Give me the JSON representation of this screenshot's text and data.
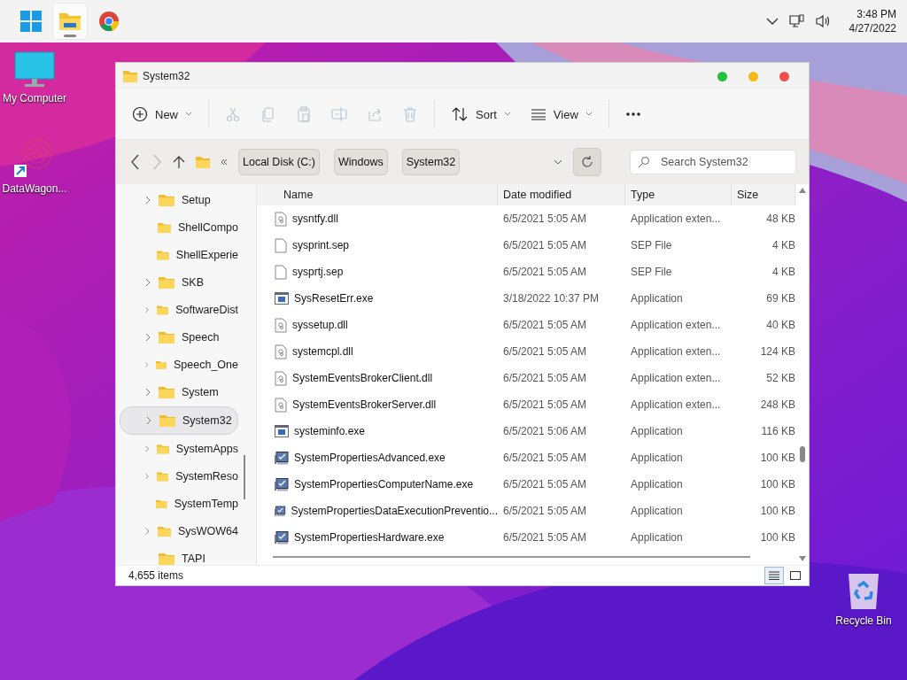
{
  "taskbar": {
    "apps": [
      {
        "kind": "start",
        "selected": false
      },
      {
        "kind": "explorer",
        "selected": true
      },
      {
        "kind": "chrome",
        "selected": false
      }
    ],
    "clock": {
      "time": "3:48 PM",
      "date": "4/27/2022"
    }
  },
  "desktop_icons": [
    {
      "kind": "computer",
      "label": "My Computer"
    },
    {
      "kind": "shortcut",
      "label": "DataWagon..."
    },
    {
      "kind": "recycle",
      "label": "Recycle Bin"
    }
  ],
  "window": {
    "title": "System32",
    "toolbar": [
      {
        "kind": "new",
        "label": "New",
        "disabled": false
      },
      {
        "kind": "cut",
        "disabled": true
      },
      {
        "kind": "copy",
        "disabled": true
      },
      {
        "kind": "paste",
        "disabled": true
      },
      {
        "kind": "rename",
        "disabled": true
      },
      {
        "kind": "share",
        "disabled": true
      },
      {
        "kind": "delete",
        "disabled": true
      },
      {
        "kind": "sort",
        "label": "Sort",
        "disabled": false
      },
      {
        "kind": "view",
        "label": "View",
        "disabled": false
      },
      {
        "kind": "more",
        "disabled": false
      }
    ],
    "breadcrumbs": [
      "Local Disk (C:)",
      "Windows",
      "System32"
    ],
    "search": {
      "placeholder": "Search System32"
    },
    "sidebar": [
      {
        "label": "Setup",
        "expandable": true,
        "selected": false
      },
      {
        "label": "ShellCompo",
        "expandable": false,
        "selected": false
      },
      {
        "label": "ShellExperie",
        "expandable": false,
        "selected": false
      },
      {
        "label": "SKB",
        "expandable": true,
        "selected": false
      },
      {
        "label": "SoftwareDist",
        "expandable": true,
        "selected": false
      },
      {
        "label": "Speech",
        "expandable": true,
        "selected": false
      },
      {
        "label": "Speech_One",
        "expandable": true,
        "selected": false
      },
      {
        "label": "System",
        "expandable": true,
        "selected": false
      },
      {
        "label": "System32",
        "expandable": true,
        "selected": true
      },
      {
        "label": "SystemApps",
        "expandable": true,
        "selected": false
      },
      {
        "label": "SystemReso",
        "expandable": true,
        "selected": false
      },
      {
        "label": "SystemTemp",
        "expandable": false,
        "selected": false
      },
      {
        "label": "SysWOW64",
        "expandable": true,
        "selected": false
      },
      {
        "label": "TAPI",
        "expandable": false,
        "selected": false
      }
    ],
    "columns": [
      "Name",
      "Date modified",
      "Type",
      "Size"
    ],
    "rows": [
      {
        "kind": "dll",
        "name": "sysntfy.dll",
        "date": "6/5/2021 5:05 AM",
        "type": "Application exten...",
        "size": "48 KB"
      },
      {
        "kind": "file",
        "name": "sysprint.sep",
        "date": "6/5/2021 5:05 AM",
        "type": "SEP File",
        "size": "4 KB"
      },
      {
        "kind": "file",
        "name": "sysprtj.sep",
        "date": "6/5/2021 5:05 AM",
        "type": "SEP File",
        "size": "4 KB"
      },
      {
        "kind": "exe",
        "name": "SysResetErr.exe",
        "date": "3/18/2022 10:37 PM",
        "type": "Application",
        "size": "69 KB"
      },
      {
        "kind": "dll",
        "name": "syssetup.dll",
        "date": "6/5/2021 5:05 AM",
        "type": "Application exten...",
        "size": "40 KB"
      },
      {
        "kind": "dll",
        "name": "systemcpl.dll",
        "date": "6/5/2021 5:05 AM",
        "type": "Application exten...",
        "size": "124 KB"
      },
      {
        "kind": "dll",
        "name": "SystemEventsBrokerClient.dll",
        "date": "6/5/2021 5:05 AM",
        "type": "Application exten...",
        "size": "52 KB"
      },
      {
        "kind": "dll",
        "name": "SystemEventsBrokerServer.dll",
        "date": "6/5/2021 5:05 AM",
        "type": "Application exten...",
        "size": "248 KB"
      },
      {
        "kind": "exe",
        "name": "systeminfo.exe",
        "date": "6/5/2021 5:06 AM",
        "type": "Application",
        "size": "116 KB"
      },
      {
        "kind": "sysprop",
        "name": "SystemPropertiesAdvanced.exe",
        "date": "6/5/2021 5:05 AM",
        "type": "Application",
        "size": "100 KB"
      },
      {
        "kind": "sysprop",
        "name": "SystemPropertiesComputerName.exe",
        "date": "6/5/2021 5:05 AM",
        "type": "Application",
        "size": "100 KB"
      },
      {
        "kind": "sysprop",
        "name": "SystemPropertiesDataExecutionPreventio...",
        "date": "6/5/2021 5:05 AM",
        "type": "Application",
        "size": "100 KB"
      },
      {
        "kind": "sysprop",
        "name": "SystemPropertiesHardware.exe",
        "date": "6/5/2021 5:05 AM",
        "type": "Application",
        "size": "100 KB"
      }
    ],
    "status": {
      "count": "4,655 items",
      "views": [
        {
          "kind": "details",
          "selected": true
        },
        {
          "kind": "tiles",
          "selected": false
        }
      ]
    }
  }
}
